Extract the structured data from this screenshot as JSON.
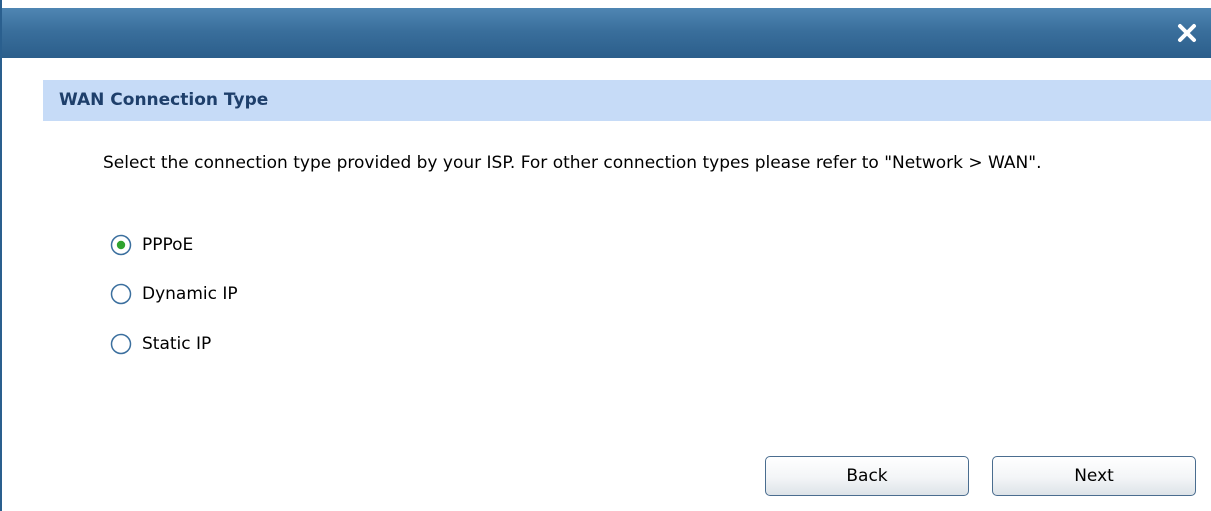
{
  "dialog": {
    "close_icon": "close-icon",
    "colors": {
      "titlebar": "#3a6f9c",
      "section_header_bg": "#c6dbf7",
      "section_title": "#1e3f6b",
      "radio_selected": "#2fa32f"
    }
  },
  "section": {
    "title": "WAN Connection Type"
  },
  "description": "Select the connection type provided by your ISP. For other connection types please refer to \"Network > WAN\".",
  "options": [
    {
      "label": "PPPoE",
      "selected": true
    },
    {
      "label": "Dynamic IP",
      "selected": false
    },
    {
      "label": "Static IP",
      "selected": false
    }
  ],
  "buttons": {
    "back_label": "Back",
    "next_label": "Next"
  }
}
